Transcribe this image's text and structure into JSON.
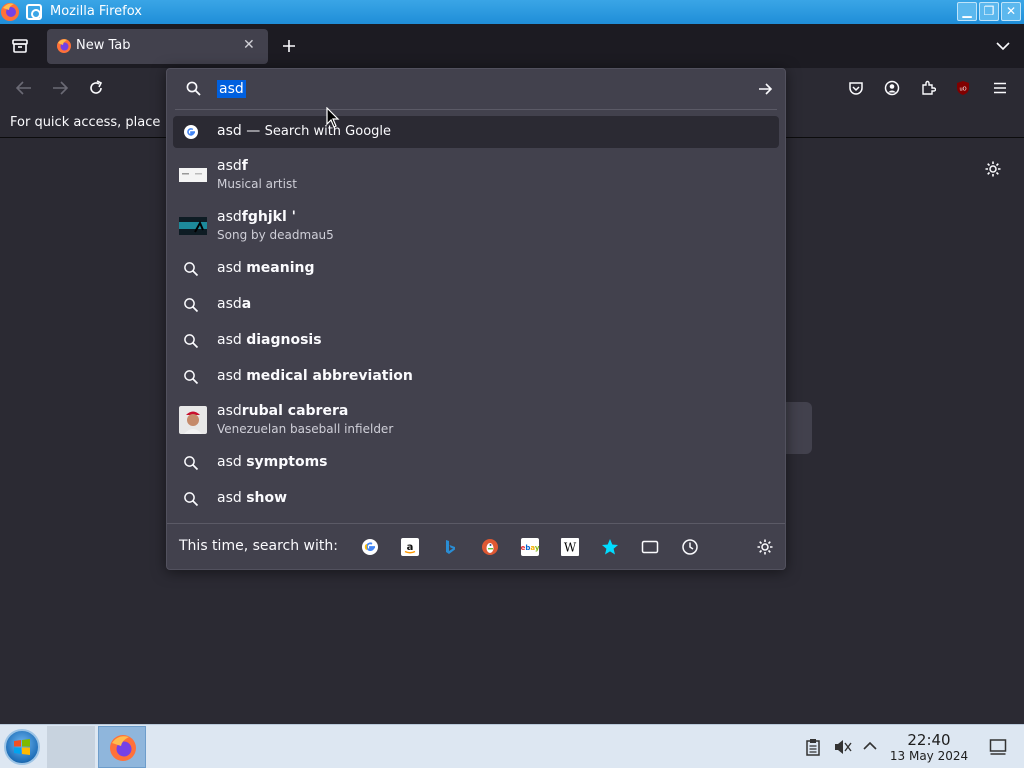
{
  "window": {
    "title": "Mozilla Firefox"
  },
  "tab": {
    "label": "New Tab"
  },
  "bookmarks": {
    "text": "For quick access, place"
  },
  "urlbar": {
    "value": "asd",
    "rows": [
      {
        "prefix": "asd",
        "bold": "",
        "suffix": " — ",
        "action": "Search with Google"
      },
      {
        "prefix": "asd",
        "bold": "f",
        "sub": "Musical artist"
      },
      {
        "prefix": "asd",
        "bold": "fghjkl '",
        "sub": "Song by deadmau5"
      },
      {
        "prefix": "asd ",
        "bold": "meaning"
      },
      {
        "prefix": "asd",
        "bold": "a"
      },
      {
        "prefix": "asd ",
        "bold": "diagnosis"
      },
      {
        "prefix": "asd ",
        "bold": "medical abbreviation"
      },
      {
        "prefix": "asd",
        "bold": "rubal cabrera",
        "sub": "Venezuelan baseball infielder"
      },
      {
        "prefix": "asd ",
        "bold": "symptoms"
      },
      {
        "prefix": "asd ",
        "bold": "show"
      }
    ],
    "oneoff_label": "This time, search with:",
    "engines": [
      "google-icon",
      "amazon-icon",
      "bing-icon",
      "duckduckgo-icon",
      "ebay-icon",
      "wikipedia-icon",
      "bookmarks-star-icon",
      "tabs-icon",
      "history-icon"
    ]
  },
  "taskbar": {
    "time": "22:40",
    "date": "13 May 2024"
  },
  "colors": {
    "accent": "#0060df",
    "popup_bg": "#42414d",
    "toolbar_bg": "#2b2a33",
    "titlebar": "#1f8ed8"
  }
}
